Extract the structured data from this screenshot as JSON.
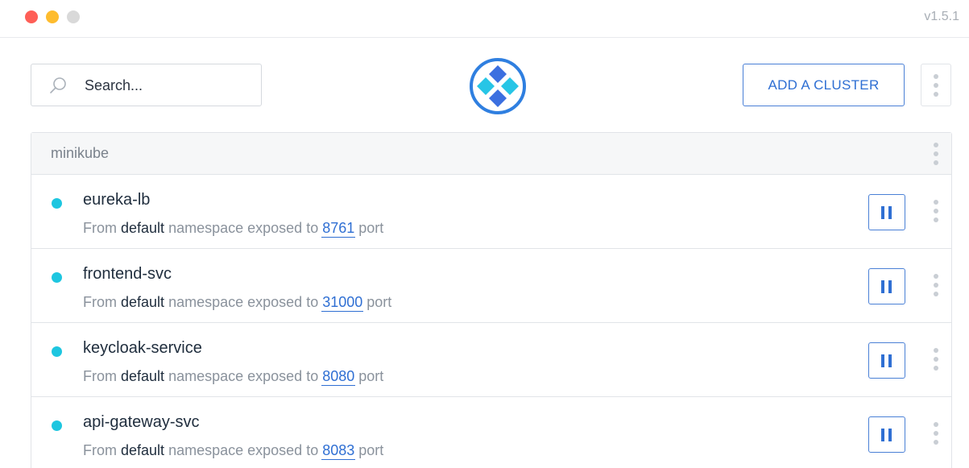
{
  "window": {
    "version": "v1.5.1"
  },
  "toolbar": {
    "search_placeholder": "Search...",
    "add_cluster_label": "ADD A CLUSTER",
    "logo_icon": "kubeforwarder-logo-icon"
  },
  "colors": {
    "accent": "#2f6fd3",
    "status_running": "#1ec6e0",
    "header_bg": "#f6f7f8",
    "logo_primary": "#3b82e6",
    "logo_secondary": "#27c5e6"
  },
  "cluster": {
    "name": "minikube",
    "services": [
      {
        "name": "eureka-lb",
        "prefix": "From",
        "namespace": "default",
        "middle": "namespace exposed to",
        "port": "8761",
        "suffix": "port",
        "status": "running",
        "action_icon": "pause-icon"
      },
      {
        "name": "frontend-svc",
        "prefix": "From",
        "namespace": "default",
        "middle": "namespace exposed to",
        "port": "31000",
        "suffix": "port",
        "status": "running",
        "action_icon": "pause-icon"
      },
      {
        "name": "keycloak-service",
        "prefix": "From",
        "namespace": "default",
        "middle": "namespace exposed to",
        "port": "8080",
        "suffix": "port",
        "status": "running",
        "action_icon": "pause-icon"
      },
      {
        "name": "api-gateway-svc",
        "prefix": "From",
        "namespace": "default",
        "middle": "namespace exposed to",
        "port": "8083",
        "suffix": "port",
        "status": "running",
        "action_icon": "pause-icon"
      }
    ]
  }
}
